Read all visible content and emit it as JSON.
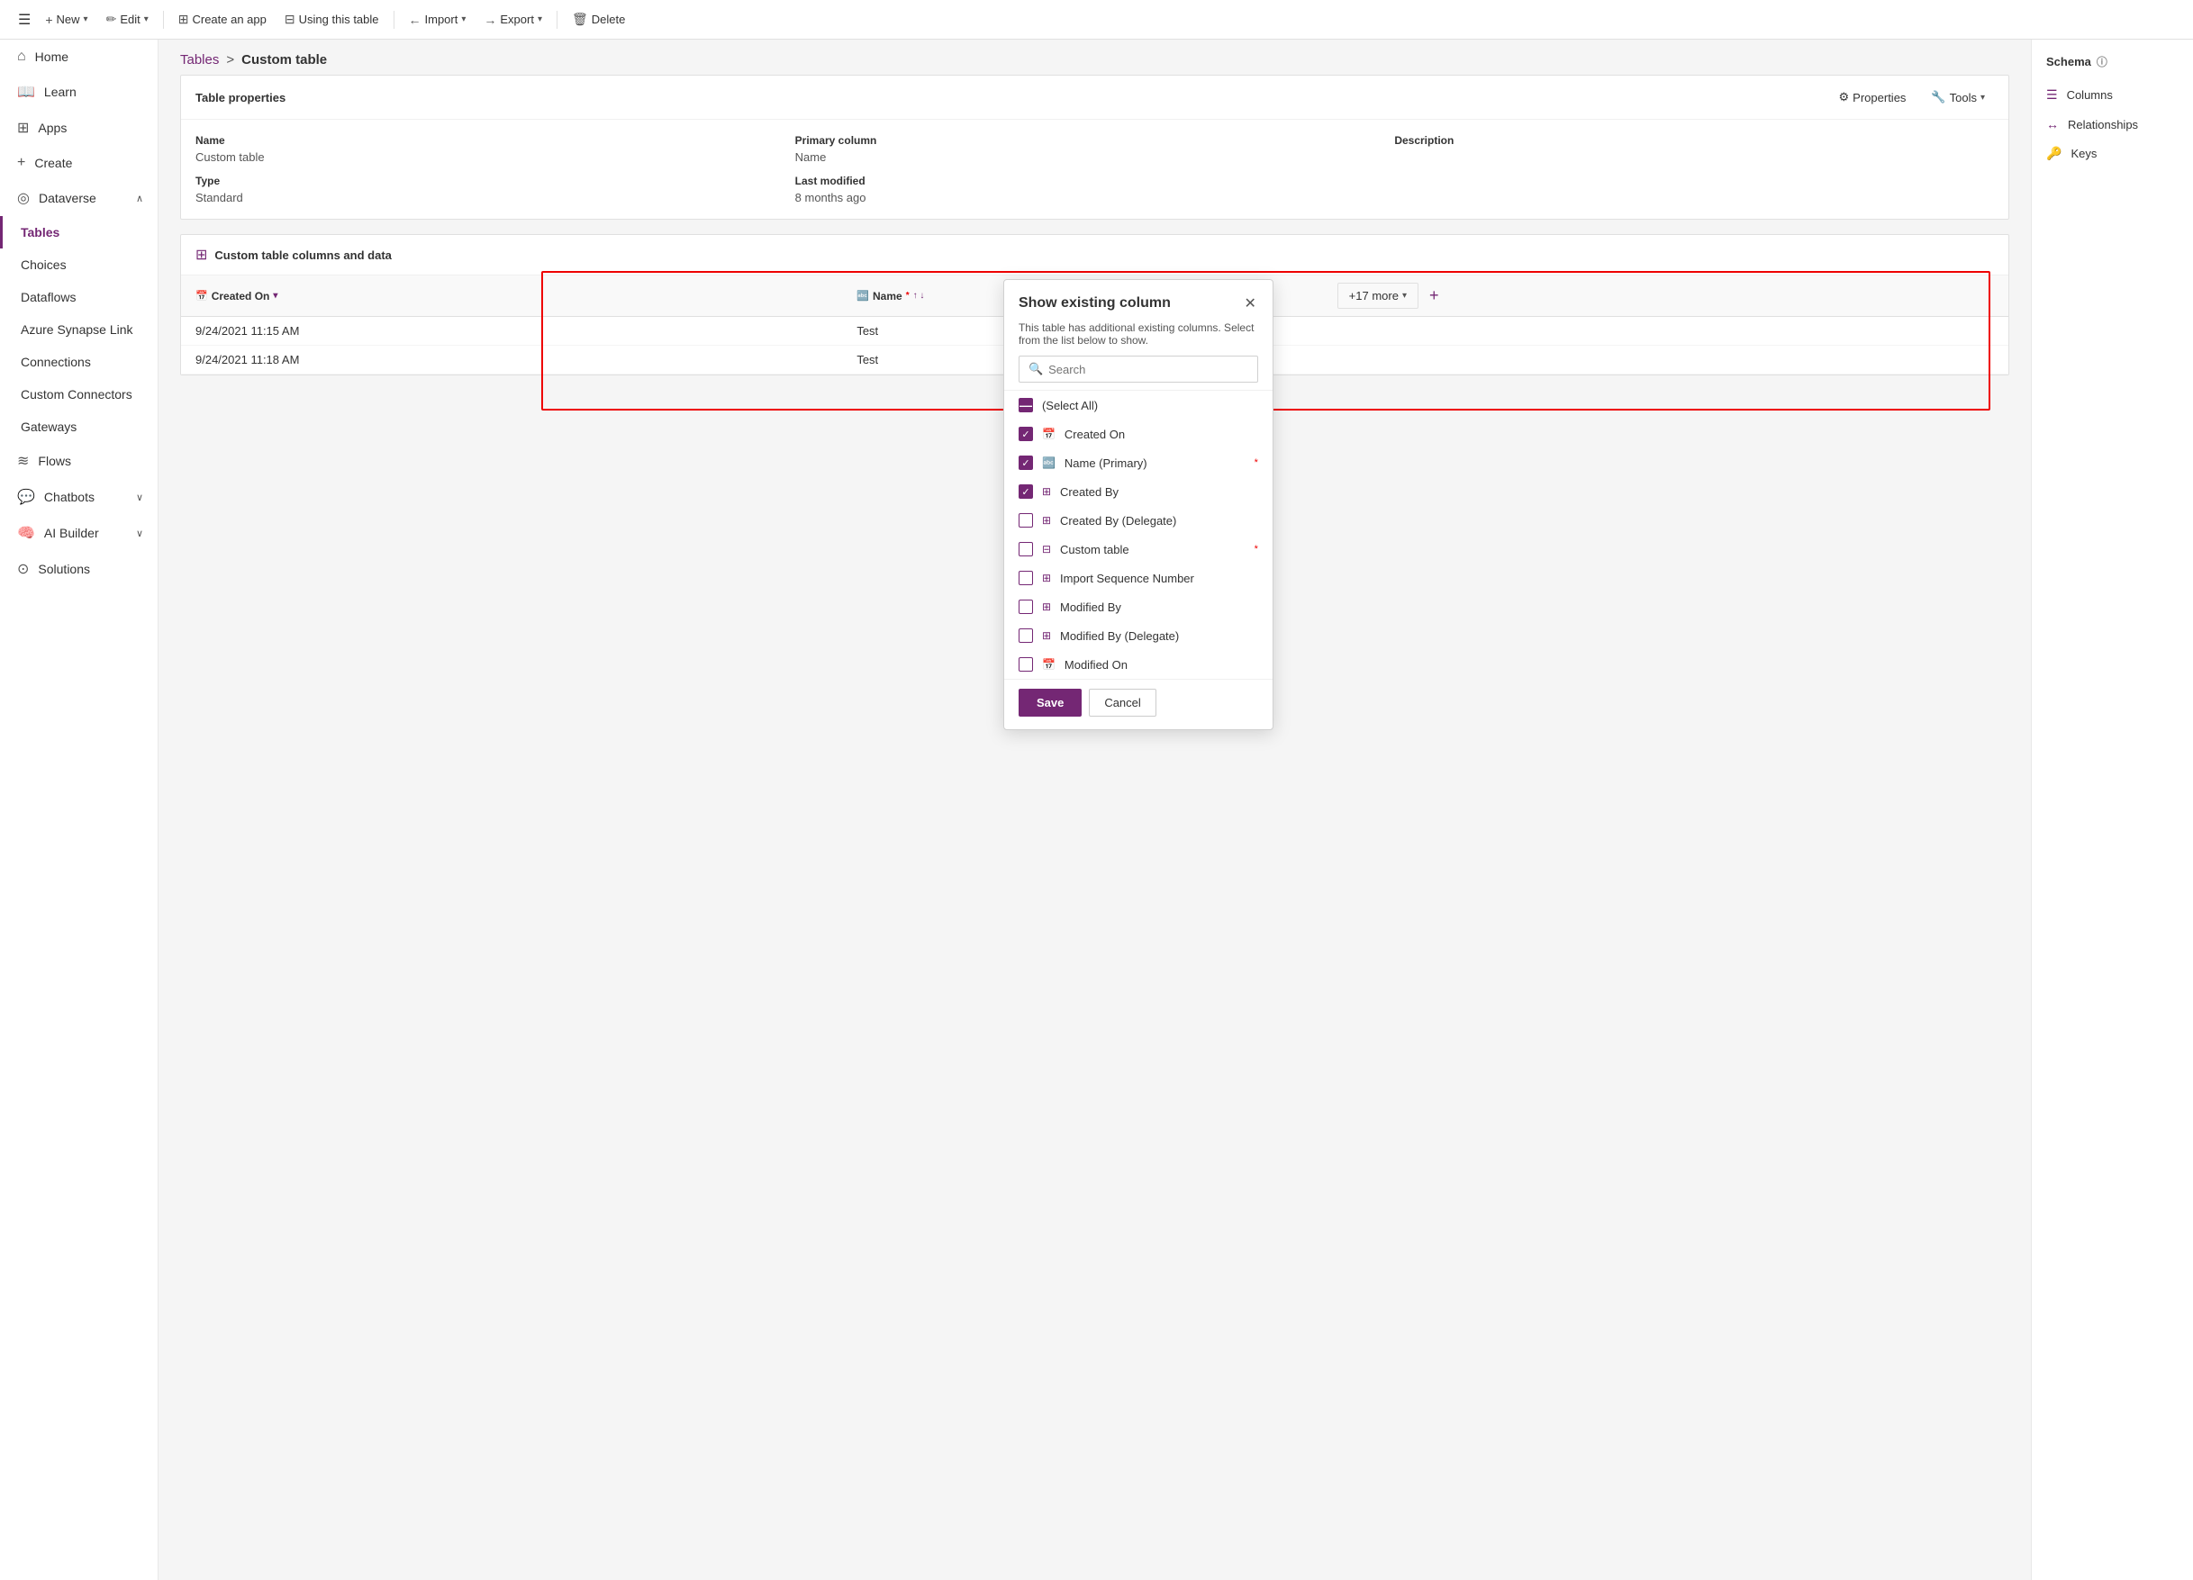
{
  "toolbar": {
    "hamburger": "☰",
    "items": [
      {
        "label": "New",
        "icon": "+",
        "has_caret": true
      },
      {
        "label": "Edit",
        "icon": "✏",
        "has_caret": true
      },
      {
        "label": "Create an app",
        "icon": "⊞",
        "has_caret": false
      },
      {
        "label": "Using this table",
        "icon": "⊟",
        "has_caret": false
      },
      {
        "label": "Import",
        "icon": "←",
        "has_caret": true
      },
      {
        "label": "Export",
        "icon": "→",
        "has_caret": true
      },
      {
        "label": "Delete",
        "icon": "🗑",
        "has_caret": false
      }
    ]
  },
  "sidebar": {
    "items": [
      {
        "label": "Home",
        "icon": "⌂",
        "indent": 0,
        "active": false
      },
      {
        "label": "Learn",
        "icon": "📖",
        "indent": 0,
        "active": false
      },
      {
        "label": "Apps",
        "icon": "⊞",
        "indent": 0,
        "active": false
      },
      {
        "label": "Create",
        "icon": "+",
        "indent": 0,
        "active": false
      },
      {
        "label": "Dataverse",
        "icon": "◎",
        "indent": 0,
        "active": false,
        "expanded": true
      },
      {
        "label": "Tables",
        "icon": "",
        "indent": 1,
        "active": true
      },
      {
        "label": "Choices",
        "icon": "",
        "indent": 1,
        "active": false
      },
      {
        "label": "Dataflows",
        "icon": "",
        "indent": 1,
        "active": false
      },
      {
        "label": "Azure Synapse Link",
        "icon": "",
        "indent": 1,
        "active": false
      },
      {
        "label": "Connections",
        "icon": "",
        "indent": 1,
        "active": false
      },
      {
        "label": "Custom Connectors",
        "icon": "",
        "indent": 1,
        "active": false
      },
      {
        "label": "Gateways",
        "icon": "",
        "indent": 1,
        "active": false
      },
      {
        "label": "Flows",
        "icon": "≋",
        "indent": 0,
        "active": false
      },
      {
        "label": "Chatbots",
        "icon": "💬",
        "indent": 0,
        "active": false,
        "has_caret": true
      },
      {
        "label": "AI Builder",
        "icon": "🧠",
        "indent": 0,
        "active": false,
        "has_caret": true
      },
      {
        "label": "Solutions",
        "icon": "⊙",
        "indent": 0,
        "active": false
      }
    ]
  },
  "breadcrumb": {
    "parent": "Tables",
    "separator": ">",
    "current": "Custom table"
  },
  "table_properties": {
    "title": "Table properties",
    "cols": [
      {
        "label": "Name",
        "value": "Custom table"
      },
      {
        "label": "Primary column",
        "value": "Name"
      },
      {
        "label": "Description",
        "value": ""
      }
    ],
    "cols2": [
      {
        "label": "Type",
        "value": "Standard"
      },
      {
        "label": "Last modified",
        "value": "8 months ago"
      },
      {
        "label": "",
        "value": ""
      }
    ],
    "actions": [
      "Properties",
      "Tools"
    ]
  },
  "data_section": {
    "title": "Custom table columns and data",
    "columns": [
      {
        "icon": "📅",
        "label": "Created On",
        "sortable": true
      },
      {
        "icon": "🔤",
        "label": "Name",
        "sortable": true,
        "primary": true
      },
      {
        "label": "+17 more"
      }
    ],
    "rows": [
      {
        "created_on": "9/24/2021 11:15 AM",
        "name": "Test"
      },
      {
        "created_on": "9/24/2021 11:18 AM",
        "name": "Test"
      }
    ]
  },
  "schema": {
    "title": "Schema",
    "items": [
      {
        "icon": "☰",
        "label": "Columns"
      },
      {
        "icon": "↔",
        "label": "Relationships"
      },
      {
        "icon": "🔑",
        "label": "Keys"
      }
    ]
  },
  "popup": {
    "title": "Show existing column",
    "description": "This table has additional existing columns. Select from the list below to show.",
    "search_placeholder": "Search",
    "items": [
      {
        "label": "(Select All)",
        "icon": "",
        "checked": "partial",
        "required": false
      },
      {
        "label": "Created On",
        "icon": "📅",
        "checked": "checked",
        "required": false
      },
      {
        "label": "Name (Primary)",
        "icon": "🔤",
        "checked": "checked",
        "required": true
      },
      {
        "label": "Created By",
        "icon": "⊞",
        "checked": "checked",
        "required": false
      },
      {
        "label": "Created By (Delegate)",
        "icon": "⊞",
        "checked": "unchecked",
        "required": false
      },
      {
        "label": "Custom table",
        "icon": "⊟",
        "checked": "unchecked",
        "required": true
      },
      {
        "label": "Import Sequence Number",
        "icon": "⊞",
        "checked": "unchecked",
        "required": false
      },
      {
        "label": "Modified By",
        "icon": "⊞",
        "checked": "unchecked",
        "required": false
      },
      {
        "label": "Modified By (Delegate)",
        "icon": "⊞",
        "checked": "unchecked",
        "required": false
      },
      {
        "label": "Modified On",
        "icon": "📅",
        "checked": "unchecked",
        "required": false
      }
    ],
    "save_label": "Save",
    "cancel_label": "Cancel"
  }
}
